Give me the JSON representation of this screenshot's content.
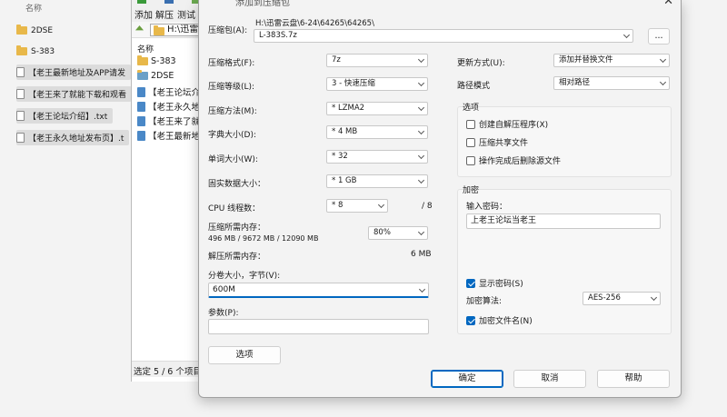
{
  "explorer": {
    "column_header": "名称",
    "items": [
      {
        "type": "folder",
        "label": "2DSE"
      },
      {
        "type": "folder",
        "label": "S-383"
      },
      {
        "type": "file",
        "label": "【老王最新地址及APP请发"
      },
      {
        "type": "file",
        "label": "【老王来了就能下载和观看"
      },
      {
        "type": "file",
        "label": "【老王论坛介绍】.txt"
      },
      {
        "type": "file",
        "label": "【老王永久地址发布页】.t"
      }
    ]
  },
  "file_manager": {
    "menu": {
      "add": "添加",
      "extract": "解压",
      "test": "测试"
    },
    "address": "H:\\迅雷",
    "list_header": "名称",
    "items": [
      {
        "type": "folder",
        "label": "S-383"
      },
      {
        "type": "folder",
        "label": "2DSE"
      },
      {
        "type": "doc",
        "label": "【老王论坛介"
      },
      {
        "type": "doc",
        "label": "【老王永久地"
      },
      {
        "type": "doc",
        "label": "【老王来了就"
      },
      {
        "type": "doc",
        "label": "【老王最新地"
      }
    ],
    "status": "选定 5 / 6 个项目"
  },
  "dialog": {
    "title": "添加到压缩包",
    "archive_label": "压缩包(A):",
    "archive_path": "H:\\迅雷云盘\\6-24\\64265\\64265\\",
    "archive_name": "L-383S.7z",
    "browse_label": "...",
    "format_label": "压缩格式(F):",
    "format_value": "7z",
    "level_label": "压缩等级(L):",
    "level_value": "3 - 快速压缩",
    "method_label": "压缩方法(M):",
    "method_value": "* LZMA2",
    "dict_label": "字典大小(D):",
    "dict_value": "* 4 MB",
    "word_label": "单词大小(W):",
    "word_value": "* 32",
    "solid_label": "固实数据大小：",
    "solid_value": "* 1 GB",
    "cpu_label": "CPU 线程数：",
    "cpu_value": "* 8",
    "cpu_max": "/ 8",
    "mem_comp_label": "压缩所需内存：",
    "mem_comp_detail": "496 MB / 9672 MB / 12090 MB",
    "mem_percent": "80%",
    "mem_decomp_label": "解压所需内存：",
    "mem_decomp_value": "6 MB",
    "split_label": "分卷大小，字节(V):",
    "split_value": "600M",
    "params_label": "参数(P):",
    "params_value": "",
    "options_button": "选项",
    "update_label": "更新方式(U):",
    "update_value": "添加并替换文件",
    "path_label": "路径模式",
    "path_value": "相对路径",
    "options_group": "选项",
    "opt_sfx": "创建自解压程序(X)",
    "opt_shared": "压缩共享文件",
    "opt_delete": "操作完成后删除源文件",
    "encrypt_group": "加密",
    "password_label": "输入密码：",
    "password_value": "上老王论坛当老王",
    "show_password": "显示密码(S)",
    "enc_method_label": "加密算法:",
    "enc_method_value": "AES-256",
    "encrypt_names": "加密文件名(N)",
    "ok": "确定",
    "cancel": "取消",
    "help": "帮助"
  },
  "colors": {
    "accent": "#0067c0",
    "folder": "#e8b84a",
    "doc": "#4a88c7"
  }
}
